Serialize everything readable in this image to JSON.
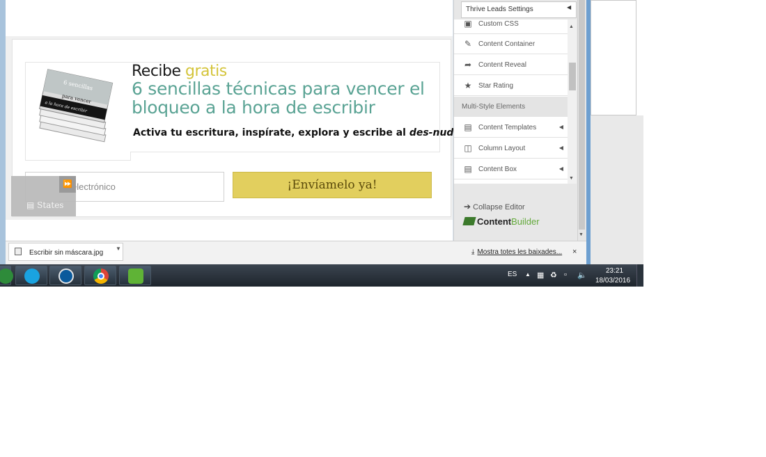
{
  "sidebar": {
    "settings_select": "Thrive Leads Settings",
    "items": [
      {
        "label": "Custom CSS",
        "icon": "css-icon"
      },
      {
        "label": "Content Container",
        "icon": "edit-icon"
      },
      {
        "label": "Content Reveal",
        "icon": "share-arrow-icon"
      },
      {
        "label": "Star Rating",
        "icon": "star-icon"
      }
    ],
    "section_label": "Multi-Style Elements",
    "multi_items": [
      {
        "label": "Content Templates",
        "icon": "document-icon"
      },
      {
        "label": "Column Layout",
        "icon": "columns-icon"
      },
      {
        "label": "Content Box",
        "icon": "box-icon"
      }
    ],
    "collapse_label": "Collapse Editor",
    "brand_first": "Content",
    "brand_second": "Builder"
  },
  "optin": {
    "recibe": "Recibe",
    "gratis": "gratis",
    "title": "6 sencillas técnicas para vencer el bloqueo a la hora de escribir",
    "subtitle_main": "Activa tu escritura, inspírate, explora y escribe al ",
    "subtitle_em": "des-nudo",
    "subtitle_end": ".",
    "email_value": "electrónico",
    "button_label": "¡Envíamelo ya!",
    "book_text_1": "6 sencillas",
    "book_text_2": "para vencer",
    "book_text_3": "el bloqueo",
    "book_text_4": "a la hora de escribir"
  },
  "states": {
    "label": "States"
  },
  "download_bar": {
    "file_name": "Escribir sin máscara.jpg",
    "show_all": "Mostra totes les baixades...",
    "close": "×"
  },
  "taskbar": {
    "language": "ES",
    "time": "23:21",
    "date": "18/03/2016"
  },
  "colors": {
    "accent_teal": "#5aa394",
    "accent_yellow": "#d4c43a",
    "button_bg": "#e2cf5e",
    "brand_green": "#63a93b"
  }
}
